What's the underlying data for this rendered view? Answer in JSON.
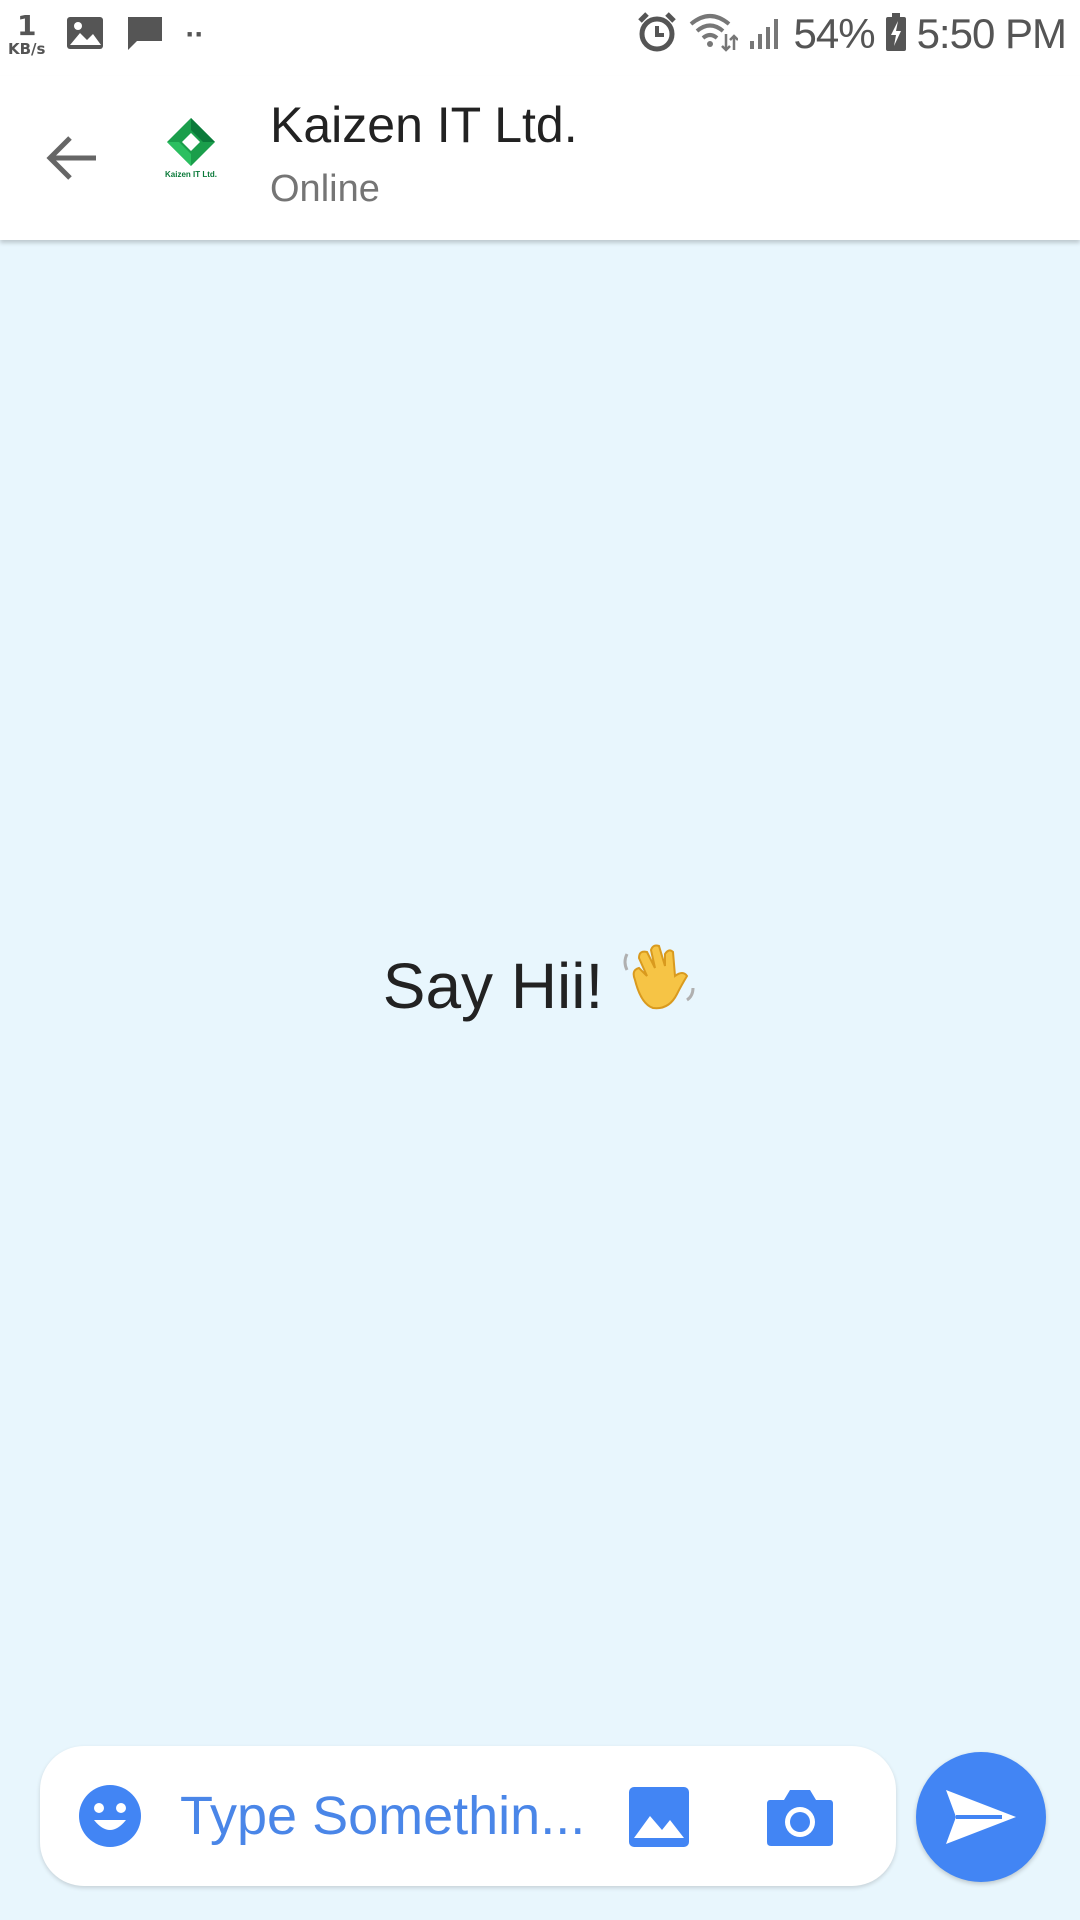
{
  "status_bar": {
    "net_speed_value": "1",
    "net_speed_unit": "KB/s",
    "battery": "54%",
    "time": "5:50 PM",
    "dots": "··"
  },
  "header": {
    "logo_text": "Kaizen IT Ltd.",
    "title": "Kaizen IT Ltd.",
    "status": "Online"
  },
  "chat": {
    "empty_message": "Say Hii!",
    "wave_emoji": "👋"
  },
  "composer": {
    "placeholder": "Type Somethin..."
  },
  "colors": {
    "accent": "#4285f4",
    "chat_background": "#e8f6fd",
    "logo_green": "#0b7a3a"
  }
}
